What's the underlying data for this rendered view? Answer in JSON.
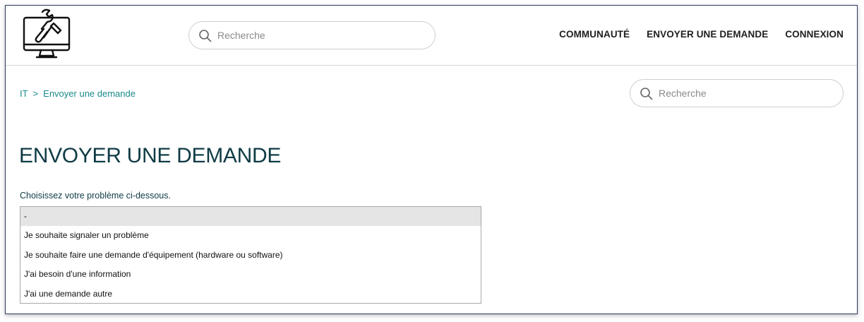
{
  "header": {
    "logo_icon": "computer-wrench-icon",
    "search": {
      "placeholder": "Recherche",
      "icon": "search-icon"
    },
    "nav": [
      "COMMUNAUTÉ",
      "ENVOYER UNE DEMANDE",
      "CONNEXION"
    ]
  },
  "breadcrumb": {
    "items": [
      "IT",
      "Envoyer une demande"
    ],
    "separator": ">"
  },
  "breadcrumb_search": {
    "placeholder": "Recherche",
    "icon": "search-icon"
  },
  "page": {
    "title": "ENVOYER UNE DEMANDE",
    "field_label": "Choisissez votre problème ci-dessous.",
    "options": [
      "-",
      "Je souhaite signaler un problème",
      "Je souhaite faire une demande d'équipement (hardware ou software)",
      "J'ai besoin d'une information",
      "J'ai une demande autre"
    ],
    "selected_option": "-"
  },
  "colors": {
    "link": "#1a8a8a",
    "title": "#0f3b45",
    "selected_option_bg": "#e5e5e5"
  }
}
